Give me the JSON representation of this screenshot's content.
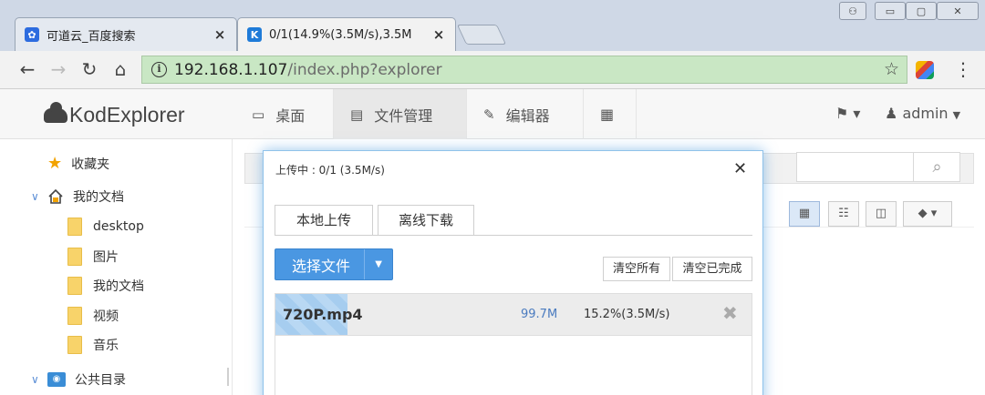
{
  "browser": {
    "tabs": [
      {
        "title": "可道云_百度搜索",
        "close": "×"
      },
      {
        "title": "0/1(14.9%(3.5M/s),3.5M",
        "close": "×"
      }
    ],
    "window_controls": {
      "user": "⚇",
      "minimize": "▭",
      "maximize": "▢",
      "close": "✕"
    },
    "url_host": "192.168.1.107",
    "url_path": "/index.php?explorer",
    "info_glyph": "i"
  },
  "app": {
    "logo": "KodExplorer",
    "nav": [
      {
        "label": "桌面"
      },
      {
        "label": "文件管理"
      },
      {
        "label": "编辑器"
      }
    ],
    "user": "admin"
  },
  "sidebar": {
    "favorites": "收藏夹",
    "mydocs": "我的文档",
    "folders": [
      "desktop",
      "图片",
      "我的文档",
      "视频",
      "音乐"
    ],
    "public": "公共目录"
  },
  "upload_dialog": {
    "title": "上传中 : 0/1 (3.5M/s)",
    "tabs": [
      "本地上传",
      "离线下载"
    ],
    "choose_file": "选择文件",
    "clear_all": "清空所有",
    "clear_done": "清空已完成",
    "file": {
      "name": "720P.mp4",
      "size": "99.7M",
      "status": "15.2%(3.5M/s)",
      "progress_percent": 15.2
    }
  },
  "colors": {
    "accent": "#4a97e2",
    "omnibox": "#c9e7c4",
    "progress": "#b9d8f3"
  }
}
